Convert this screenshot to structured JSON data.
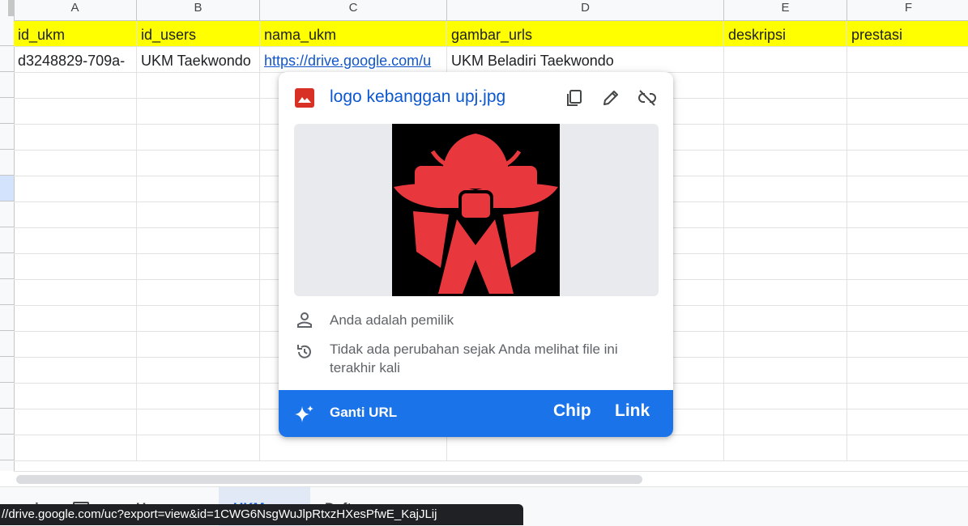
{
  "columns": [
    {
      "letter": "A",
      "header": "id_ukm"
    },
    {
      "letter": "B",
      "header": "id_users"
    },
    {
      "letter": "C",
      "header": "nama_ukm"
    },
    {
      "letter": "D",
      "header": "gambar_urls"
    },
    {
      "letter": "E",
      "header": "deskripsi"
    },
    {
      "letter": "F",
      "header": "prestasi"
    }
  ],
  "rows": [
    [
      "d3248829-709a-",
      "UKM Taekwondo",
      "https://drive.google.com/u",
      "UKM Beladiri Taekwondo",
      "",
      ""
    ]
  ],
  "header_row_color": "#ffff00",
  "popup": {
    "file_name": "logo kebanggan upj.jpg",
    "file_type_icon": "image-file-icon",
    "actions": [
      "copy-icon",
      "edit-icon",
      "unlink-icon"
    ],
    "owner_text": "Anda adalah pemilik",
    "history_text": "Tidak ada perubahan sejak Anda melihat file ini terakhir kali",
    "replace_url_label": "Ganti URL",
    "chip_label": "Chip",
    "link_label": "Link",
    "accent_color": "#1a73e8"
  },
  "sheet_tabs": [
    {
      "label": "…i…"
    },
    {
      "label": "U…"
    },
    {
      "label": "UKM",
      "active": true
    },
    {
      "label": "Daft…"
    }
  ],
  "status_url": "//drive.google.com/uc?export=view&id=1CWG6NsgWuJlpRtxzHXesPfwE_KajJLij"
}
